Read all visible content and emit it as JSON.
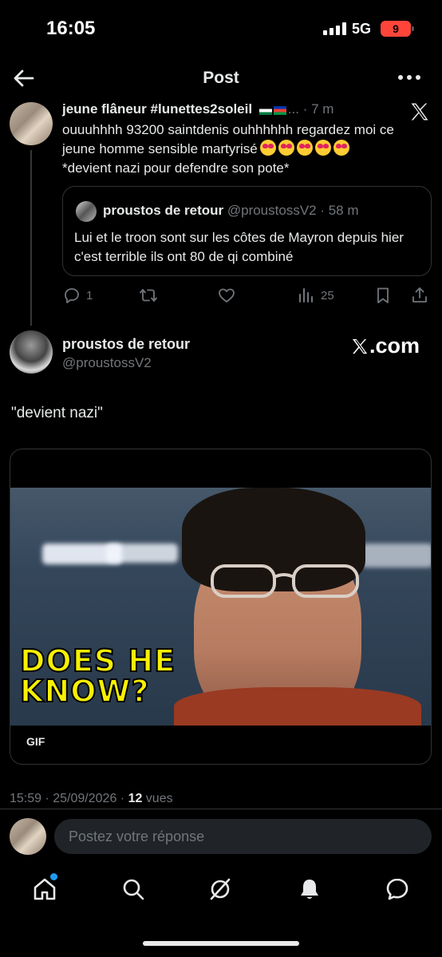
{
  "status_bar": {
    "time": "16:05",
    "network": "5G",
    "battery": "9"
  },
  "header": {
    "title": "Post"
  },
  "reply_tweet": {
    "name": "jeune flâneur #lunettes2soleil",
    "meta": "· 7 m",
    "text_line1": "ouuuhhhh 93200 saintdenis ouhhhhhh regardez moi ce jeune homme sensible martyrisé",
    "text_line2": "*devient nazi pour defendre son pote*",
    "quote": {
      "name": "proustos de retour",
      "handle_time": "@proustossV2 · 58 m",
      "text": "Lui et le troon sont sur les côtes de Mayron depuis hier c'est terrible ils ont 80 de qi combiné"
    },
    "counts": {
      "replies": "1",
      "views": "25"
    }
  },
  "main_tweet": {
    "name": "proustos de retour",
    "handle": "@proustossV2",
    "brand": ".com",
    "text": "\"devient nazi\"",
    "gif_caption_1": "DOES HE",
    "gif_caption_2": "KNOW?",
    "gif_badge": "GIF",
    "timestamp": "15:59 · 25/09/2026 · ",
    "views_count": "12",
    "views_label": " vues"
  },
  "reply_input": {
    "placeholder": "Postez votre réponse"
  },
  "colors": {
    "accent": "#1d9bf0",
    "text": "#e7e9ea",
    "muted": "#71767b",
    "border": "#2f3336",
    "gif_text": "#f7f000"
  },
  "icons": [
    "back-arrow-icon",
    "more-icon",
    "x-logo-icon",
    "reply-icon",
    "repost-icon",
    "like-icon",
    "views-icon",
    "bookmark-icon",
    "share-icon",
    "home-icon",
    "search-icon",
    "grok-icon",
    "notifications-icon",
    "messages-icon"
  ]
}
